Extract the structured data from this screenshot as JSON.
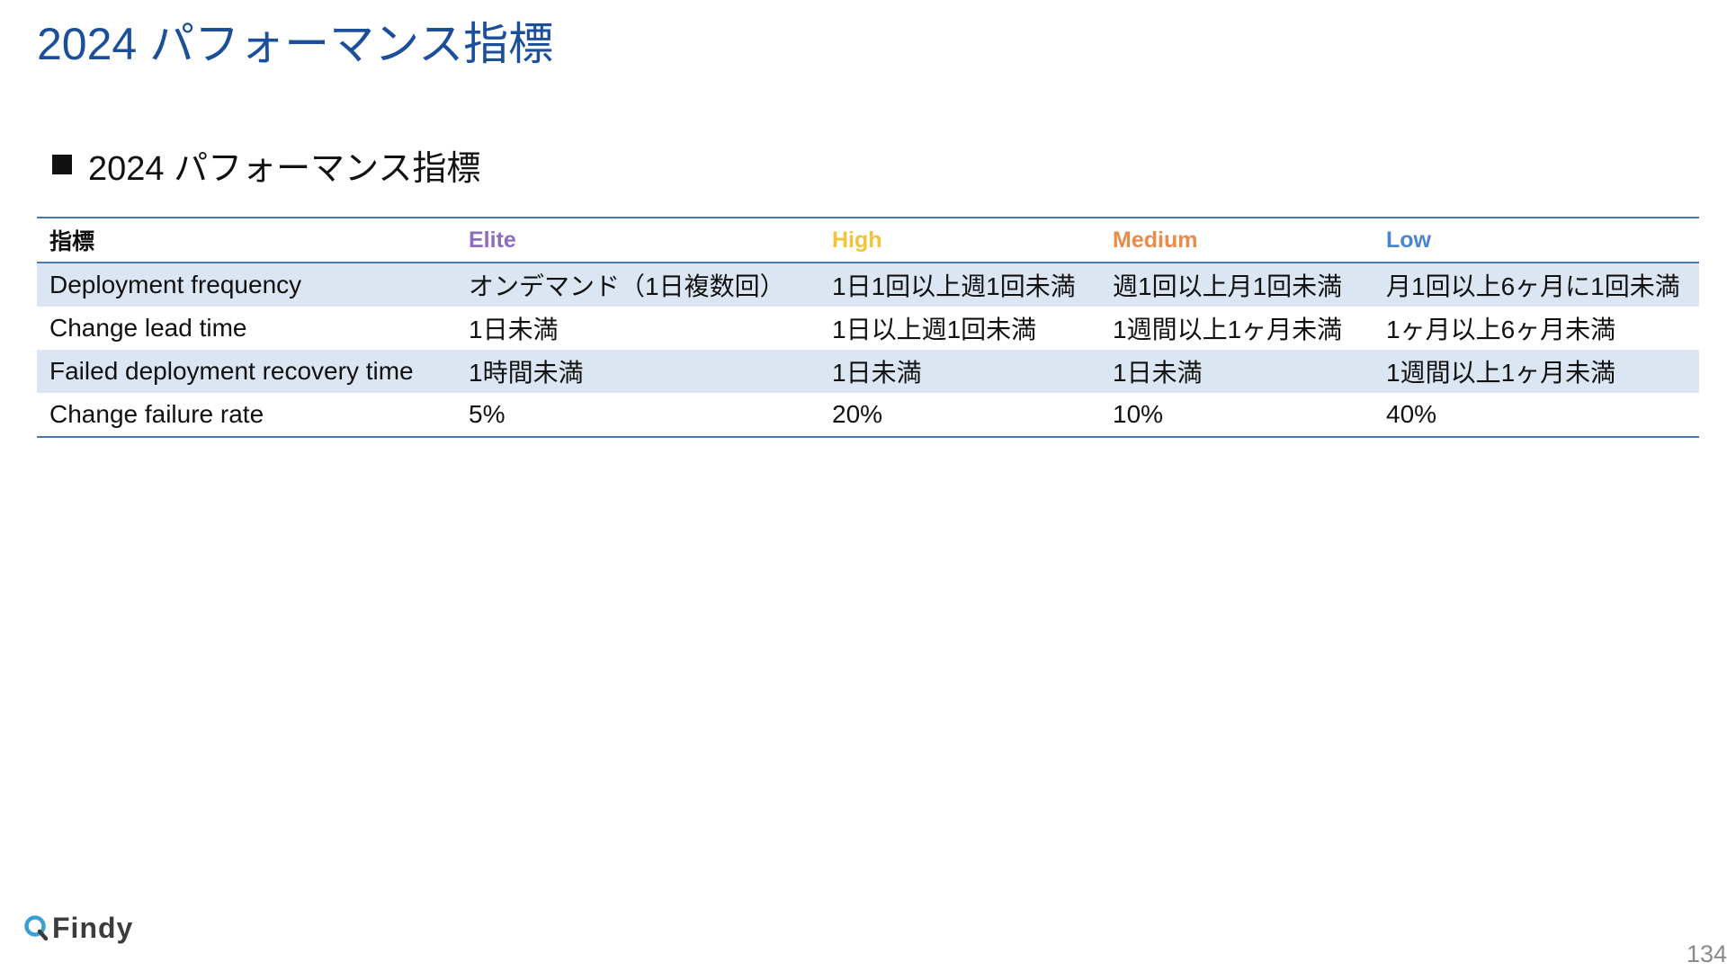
{
  "slide": {
    "title": "2024 パフォーマンス指標",
    "section_heading": "2024 パフォーマンス指標",
    "page_number": "134",
    "logo_text": "Findy"
  },
  "table": {
    "headers": [
      {
        "label": "指標",
        "color": "#111111"
      },
      {
        "label": "Elite",
        "color": "#8e6bbf"
      },
      {
        "label": "High",
        "color": "#f0c43a"
      },
      {
        "label": "Medium",
        "color": "#ec8a4a"
      },
      {
        "label": "Low",
        "color": "#4a86d0"
      }
    ],
    "rows": [
      [
        "Deployment frequency",
        "オンデマンド（1日複数回）",
        "1日1回以上週1回未満",
        "週1回以上月1回未満",
        "月1回以上6ヶ月に1回未満"
      ],
      [
        "Change lead time",
        "1日未満",
        "1日以上週1回未満",
        "1週間以上1ヶ月未満",
        "1ヶ月以上6ヶ月未満"
      ],
      [
        "Failed deployment recovery time",
        "1時間未満",
        "1日未満",
        "1日未満",
        "1週間以上1ヶ月未満"
      ],
      [
        "Change failure rate",
        "5%",
        "20%",
        "10%",
        "40%"
      ]
    ]
  },
  "colors": {
    "title": "#1b4f9c",
    "table_rule": "#4a78b5",
    "row_shade": "#dce6f3",
    "logo_mark": "#3a9fd6"
  },
  "icons": {
    "logo_mark": "findy-logo-icon",
    "bullet": "square-bullet-icon"
  }
}
